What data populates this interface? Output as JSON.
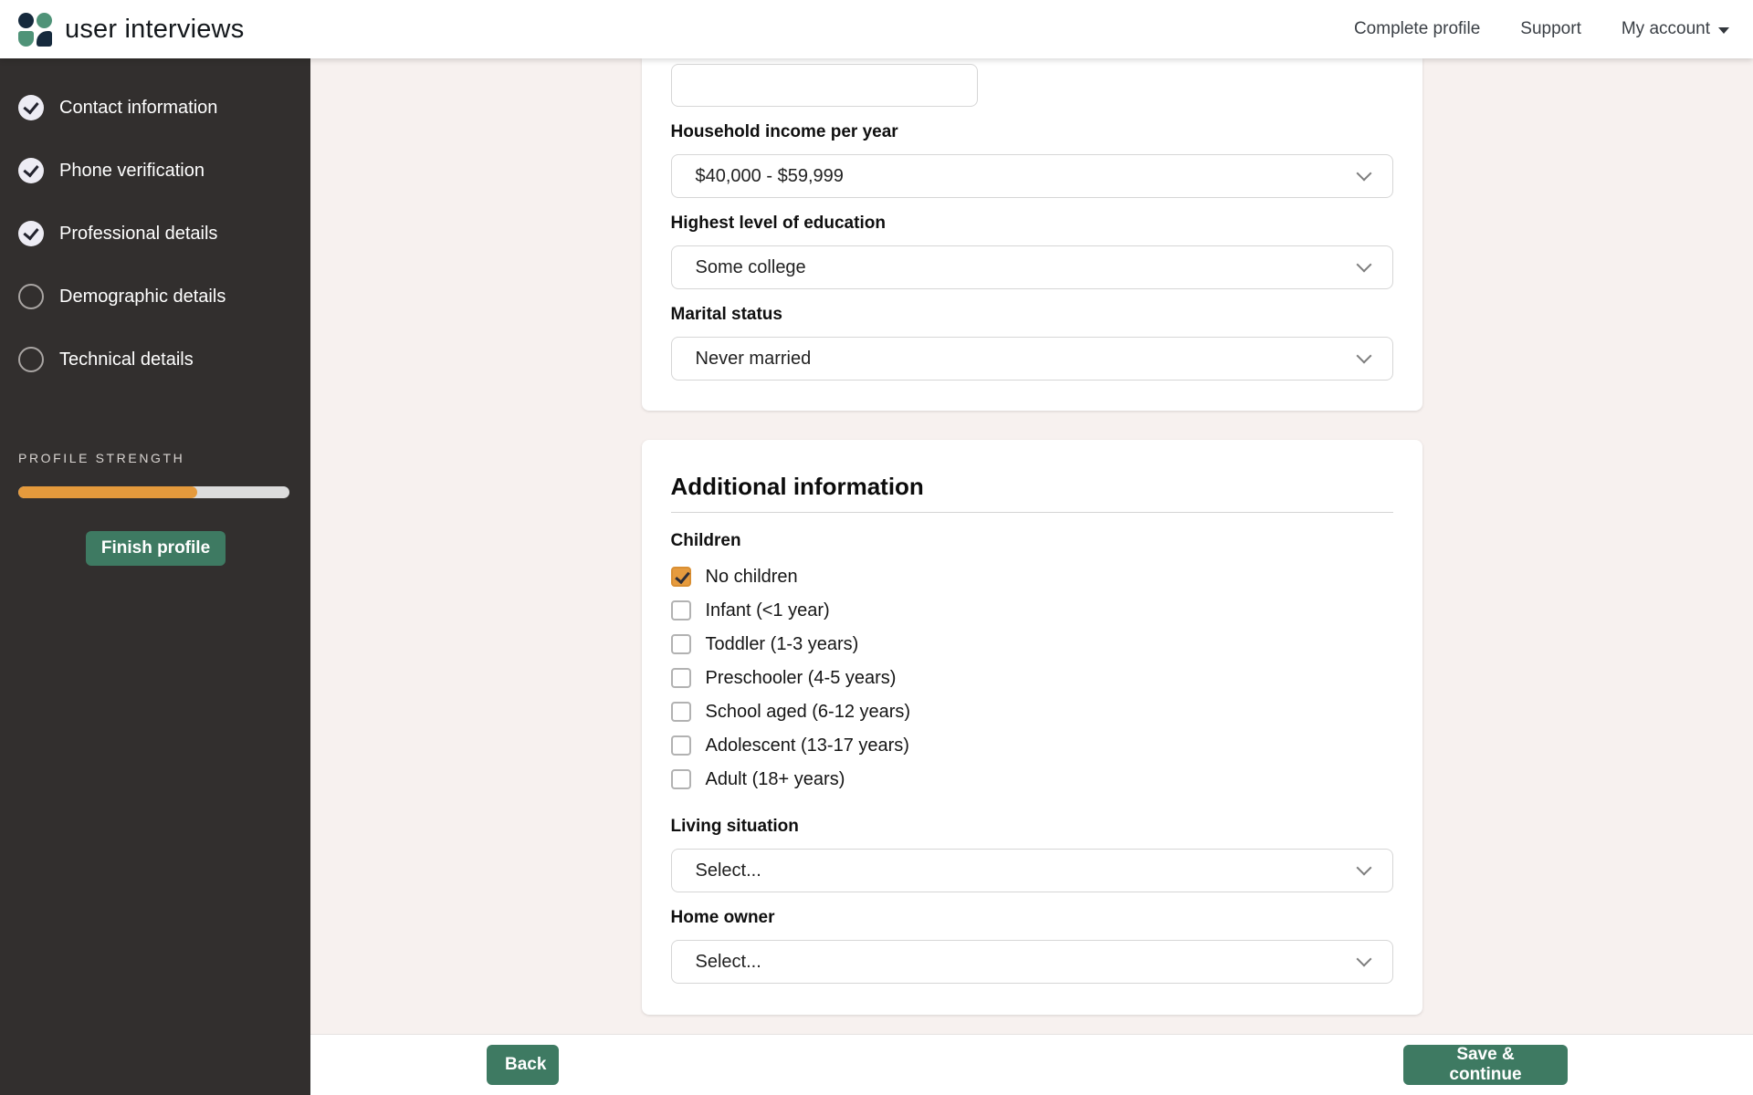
{
  "header": {
    "brand": "user interviews",
    "nav": [
      {
        "label": "Complete profile"
      },
      {
        "label": "Support"
      },
      {
        "label": "My account"
      }
    ]
  },
  "sidebar": {
    "steps": [
      {
        "label": "Contact information",
        "done": true
      },
      {
        "label": "Phone verification",
        "done": true
      },
      {
        "label": "Professional details",
        "done": true
      },
      {
        "label": "Demographic details",
        "done": false
      },
      {
        "label": "Technical details",
        "done": false
      }
    ],
    "profile_strength_label": "PROFILE STRENGTH",
    "profile_strength_percent": 66,
    "finish_button_label": "Finish profile"
  },
  "demographics_card": {
    "top_input": {
      "value": "",
      "placeholder": ""
    },
    "fields": [
      {
        "label": "Household income per year",
        "value": "$40,000 - $59,999"
      },
      {
        "label": "Highest level of education",
        "value": "Some college"
      },
      {
        "label": "Marital status",
        "value": "Never married"
      }
    ]
  },
  "additional_card": {
    "title": "Additional information",
    "children_group_label": "Children",
    "children_options": [
      {
        "label": "No children",
        "checked": true
      },
      {
        "label": "Infant (<1 year)",
        "checked": false
      },
      {
        "label": "Toddler (1-3 years)",
        "checked": false
      },
      {
        "label": "Preschooler (4-5 years)",
        "checked": false
      },
      {
        "label": "School aged (6-12 years)",
        "checked": false
      },
      {
        "label": "Adolescent (13-17 years)",
        "checked": false
      },
      {
        "label": "Adult (18+ years)",
        "checked": false
      }
    ],
    "selects": [
      {
        "label": "Living situation",
        "value": "Select..."
      },
      {
        "label": "Home owner",
        "value": "Select..."
      }
    ]
  },
  "footer": {
    "back_label": "Back",
    "save_label": "Save & continue"
  },
  "colors": {
    "accent_green": "#3e7a62",
    "accent_orange": "#e59a3c",
    "sidebar_bg": "#322f2e",
    "page_bg": "#f7f1ef"
  }
}
